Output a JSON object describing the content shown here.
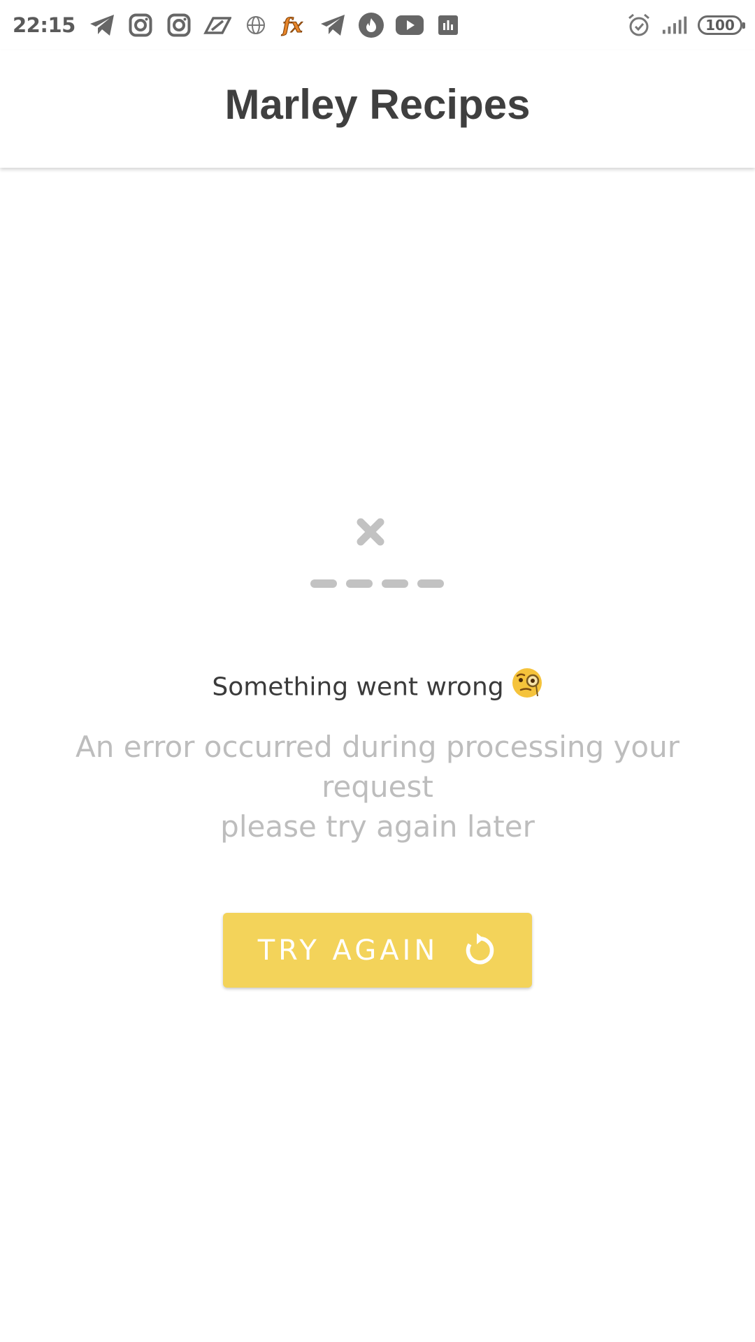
{
  "status_bar": {
    "time": "22:15",
    "battery_level": "100",
    "notification_icons": [
      "telegram-icon",
      "instagram-icon",
      "instagram-icon",
      "slash-app-icon",
      "globe-icon",
      "fx-icon",
      "telegram-icon",
      "tinder-icon",
      "youtube-icon",
      "stats-icon"
    ],
    "system_icons": [
      "alarm-icon",
      "signal-icon",
      "battery-icon"
    ]
  },
  "app_bar": {
    "title": "Marley Recipes"
  },
  "error": {
    "illustration_icon": "error-x-icon",
    "title": "Something went wrong",
    "title_emoji_icon": "monocle-face-emoji-icon",
    "message_lines": [
      "An error occurred during processing your",
      "request",
      "please try again later"
    ],
    "retry_button_label": "TRY AGAIN",
    "retry_icon": "refresh-icon"
  },
  "colors": {
    "accent": "#f3d35a",
    "title_text": "#3f3f3f",
    "muted_text": "#bdbdbd",
    "illustration": "#c2c2c2"
  }
}
